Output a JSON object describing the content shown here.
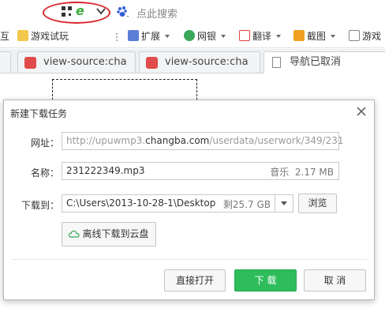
{
  "address_bar": {
    "search_hint": "点此搜索"
  },
  "toolbar": {
    "partial_left": "互",
    "items": [
      {
        "label": "游戏试玩",
        "icon": "folder-icon"
      },
      {
        "label": "扩展",
        "icon": "extension-icon"
      },
      {
        "label": "网银",
        "icon": "bank-shield-icon"
      },
      {
        "label": "翻译",
        "icon": "translate-icon"
      },
      {
        "label": "截图",
        "icon": "screenshot-icon"
      },
      {
        "label": "游戏",
        "icon": "gamepad-icon"
      }
    ]
  },
  "tabs": [
    {
      "label": "view-source:cha"
    },
    {
      "label": "view-source:cha"
    },
    {
      "label": "导航已取消",
      "active": true
    }
  ],
  "dialog": {
    "title": "新建下载任务",
    "url_label": "网址：",
    "url_prefix": "http://upuwmp3.",
    "url_domain": "changba.com",
    "url_suffix": "/userdata/userwork/349/231",
    "name_label": "名称：",
    "file_name": "231222349.mp3",
    "file_type": "音乐",
    "file_size": "2.17 MB",
    "save_label": "下载到：",
    "save_path": "C:\\Users\\2013-10-28-1\\Desktop",
    "free_space": "剩25.7 GB",
    "browse_button": "浏览",
    "cloud_button": "离线下载到云盘",
    "open_button": "直接打开",
    "download_button": "下 载",
    "cancel_button": "取 消"
  },
  "colors": {
    "highlight_oval": "#d9262c",
    "primary_button": "#2fbd5c"
  }
}
